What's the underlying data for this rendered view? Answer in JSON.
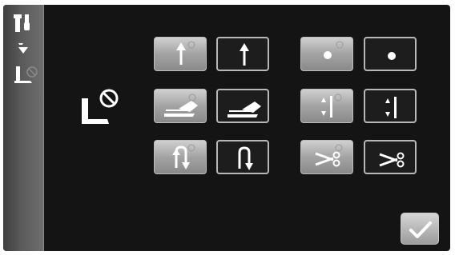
{
  "sidebar": {
    "icons": [
      "tools-icon",
      "down-arrow-icon",
      "presser-foot-icon"
    ]
  },
  "main": {
    "icon": "presser-foot-disabled-icon"
  },
  "settings": {
    "groups": [
      {
        "icon": "presser-foot-up-icon",
        "selected": "left"
      },
      {
        "icon": "presser-foot-pedal-icon",
        "selected": "left"
      },
      {
        "icon": "presser-foot-up-after-stop-icon",
        "selected": "left"
      },
      {
        "icon": "dot-icon",
        "selected": "left"
      },
      {
        "icon": "needle-up-down-icon",
        "selected": "left"
      },
      {
        "icon": "thread-cut-icon",
        "selected": "left"
      }
    ]
  },
  "colors": {
    "background": "#141414",
    "selected_button": "#a8a8a8",
    "icon_white": "#ffffff"
  },
  "confirm": {
    "icon": "checkmark-icon"
  }
}
